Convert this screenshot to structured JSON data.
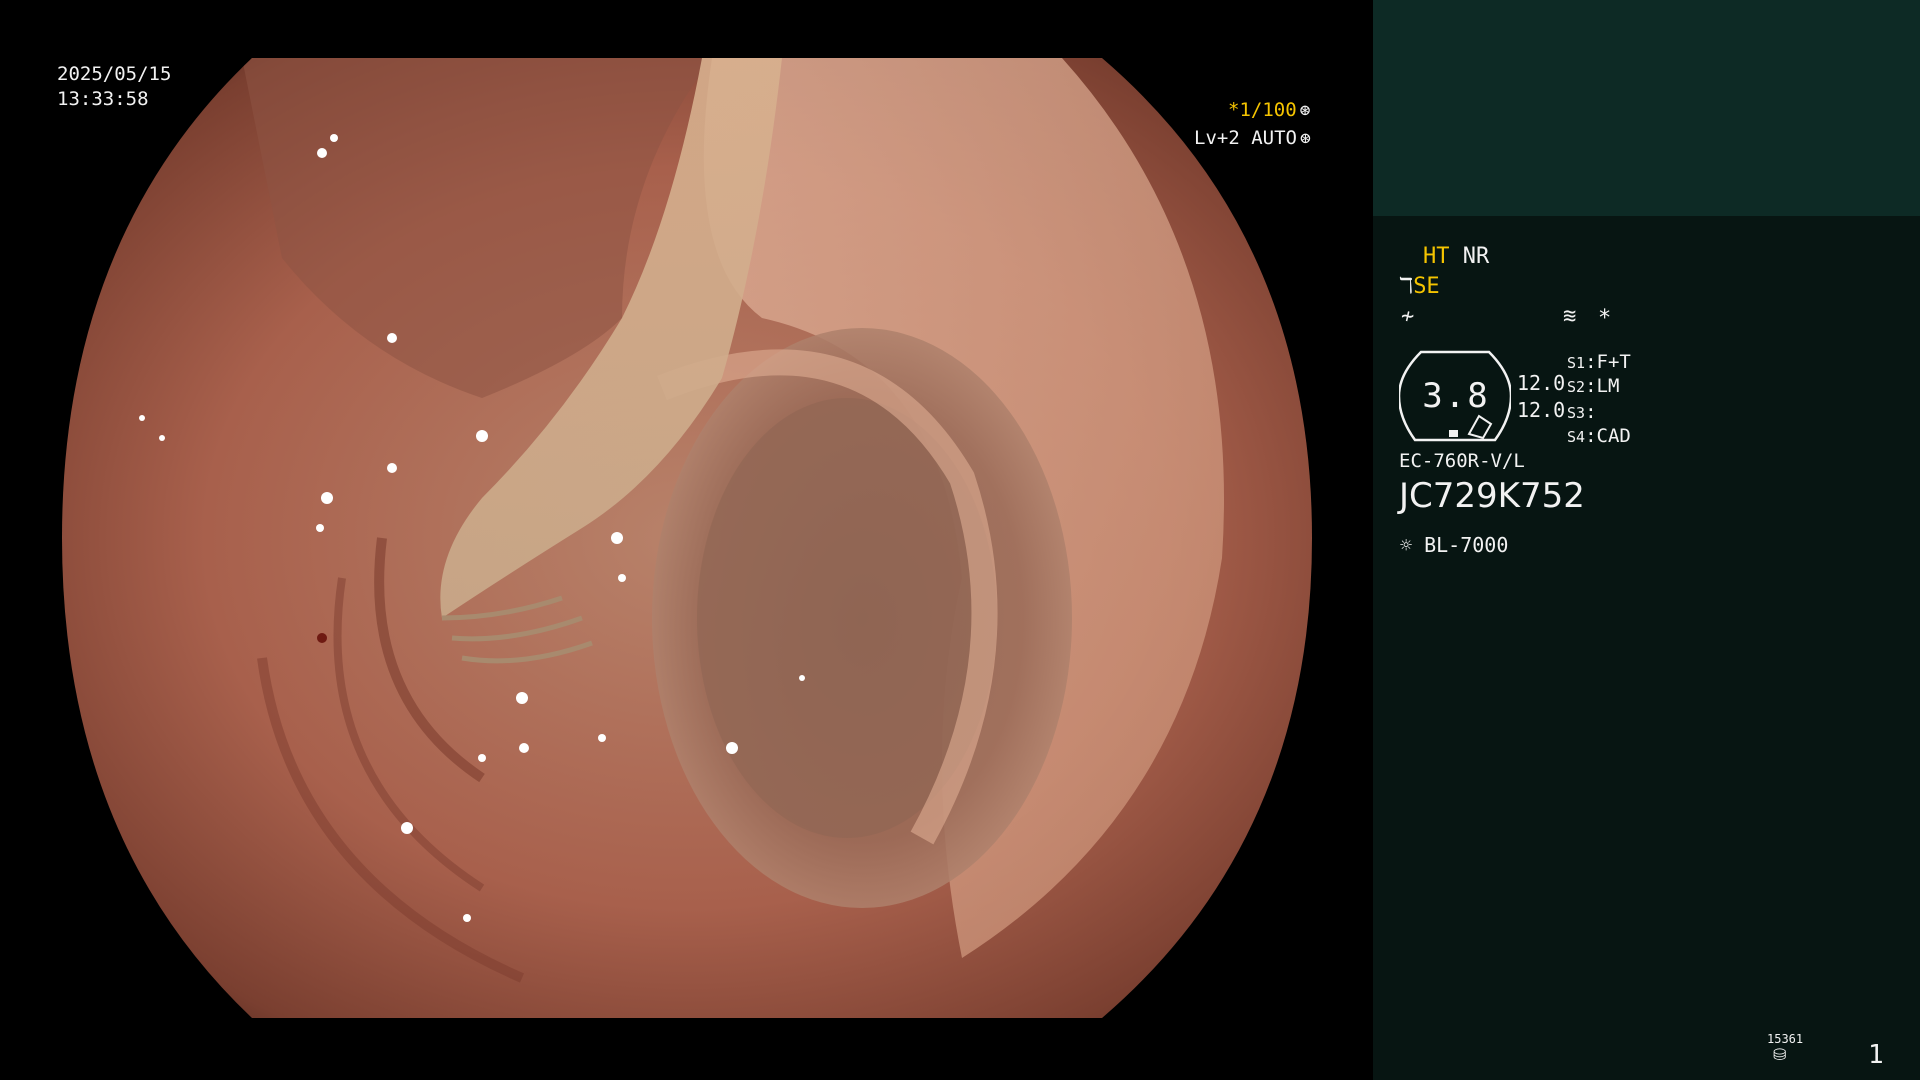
{
  "datetime": {
    "date": "2025/05/15",
    "time": "13:33:58"
  },
  "shutter": {
    "value": "*1/100",
    "icon": "shutter-icon"
  },
  "iris": {
    "value": "Lv+2 AUTO",
    "icon": "iris-icon"
  },
  "panel": {
    "ht": "HT",
    "nr": "NR",
    "se": "SE",
    "se_icon": "enhancement-icon",
    "struct_icon": "structure-icon",
    "color_icon": "color-mode-icon",
    "asterisk": "*",
    "magnification": "3.8",
    "left_value_1": "12.0",
    "left_value_2": "12.0",
    "switches": [
      {
        "key": "S1",
        "value": "F+T"
      },
      {
        "key": "S2",
        "value": "LM"
      },
      {
        "key": "S3",
        "value": ""
      },
      {
        "key": "S4",
        "value": "CAD"
      }
    ],
    "scope_model": "EC-760R-V/L",
    "scope_serial": "JC729K752",
    "light_icon": "light-source-icon",
    "light_source": "BL-7000",
    "counter_small": "15361",
    "storage_icon": "storage-icon",
    "page_number": "1"
  },
  "colors": {
    "panel_top": "#0d2a25",
    "panel_body": "#071512",
    "accent_yellow": "#f5c400",
    "text": "#f2f2f2"
  }
}
